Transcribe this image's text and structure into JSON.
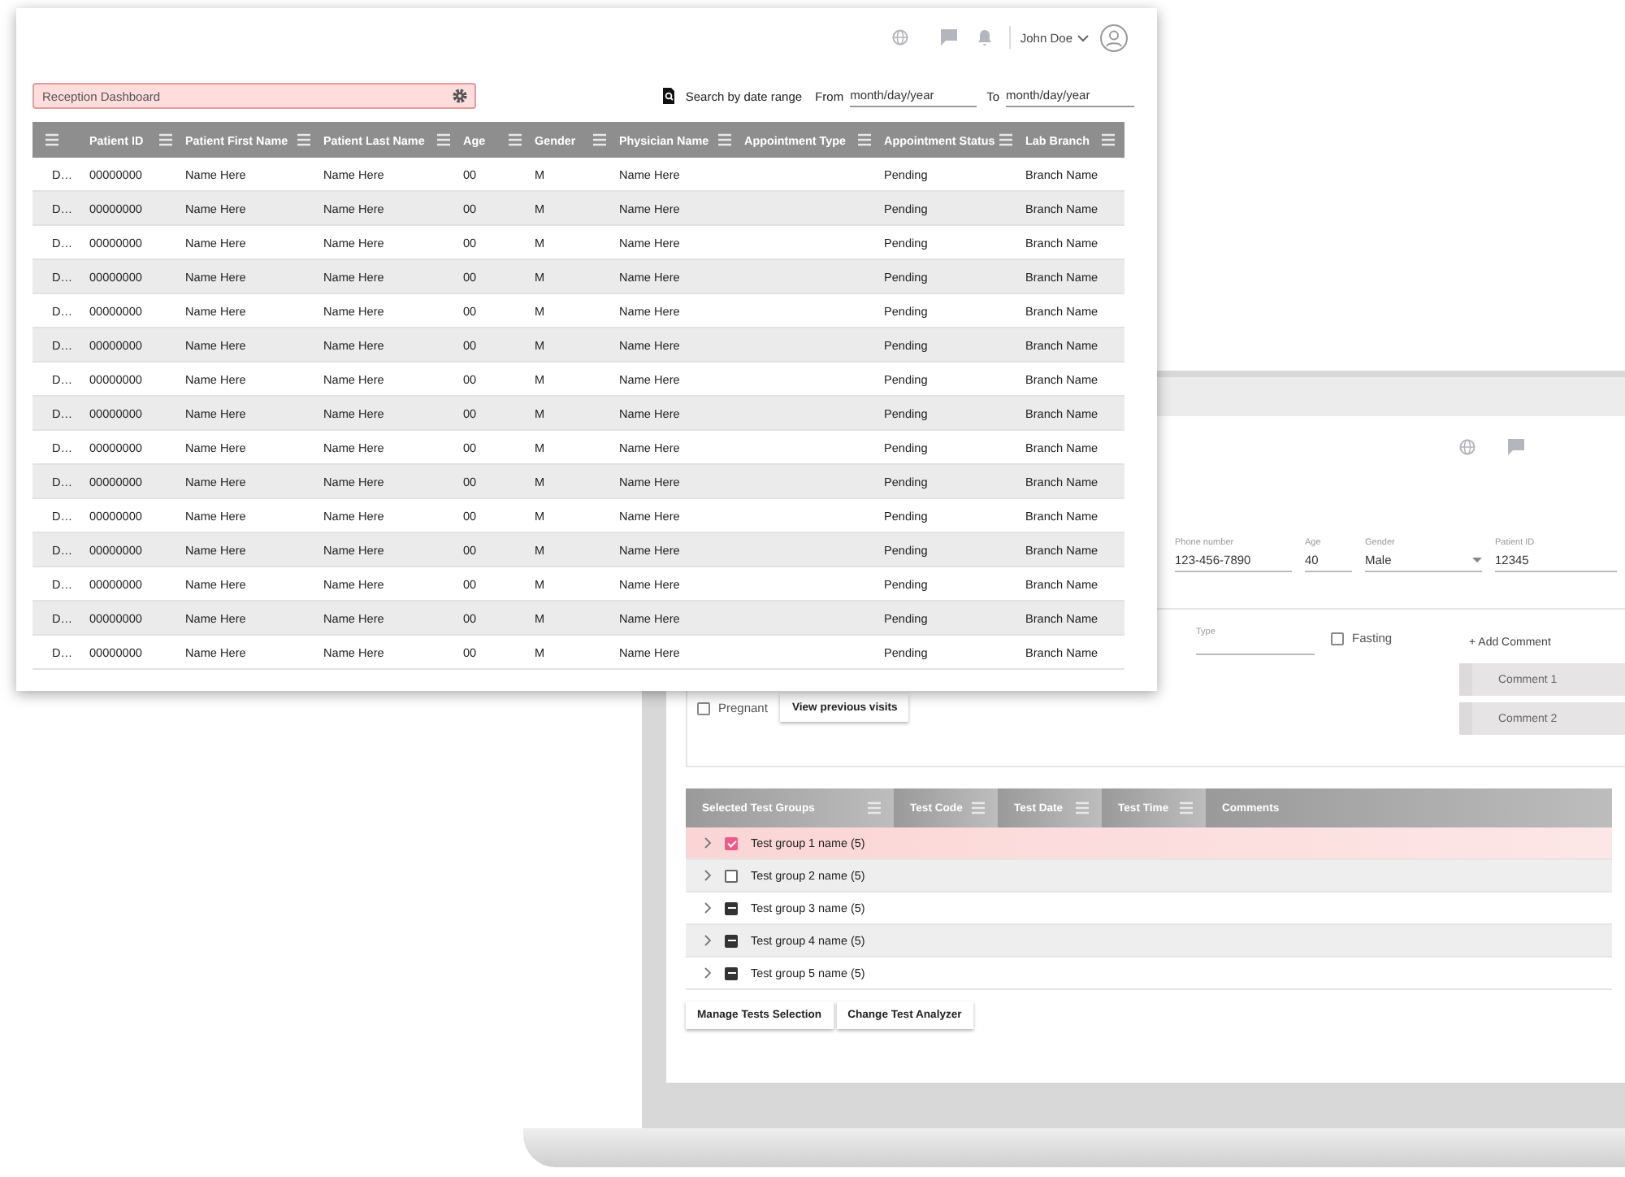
{
  "dashboard_window": {
    "header": {
      "user_name": "John Doe"
    },
    "title_field": {
      "value": "Reception Dashboard"
    },
    "date_search": {
      "label": "Search by date range",
      "from_label": "From",
      "from_placeholder": "month/day/year",
      "to_label": "To",
      "to_placeholder": "month/day/year"
    },
    "table": {
      "columns": [
        "Patient ID",
        "Patient First Name",
        "Patient Last Name",
        "Age",
        "Gender",
        "Physician Name",
        "Appointment Type",
        "Appointment Status",
        "Lab Branch"
      ],
      "rows": [
        {
          "column_1": "D…",
          "patient_id": "00000000",
          "first_name": "Name Here",
          "last_name": "Name Here",
          "age": "00",
          "gender": "M",
          "physician": "Name Here",
          "status": "Pending",
          "branch": "Branch Name"
        },
        {
          "column_1": "D…",
          "patient_id": "00000000",
          "first_name": "Name Here",
          "last_name": "Name Here",
          "age": "00",
          "gender": "M",
          "physician": "Name Here",
          "status": "Pending",
          "branch": "Branch Name"
        },
        {
          "column_1": "D…",
          "patient_id": "00000000",
          "first_name": "Name Here",
          "last_name": "Name Here",
          "age": "00",
          "gender": "M",
          "physician": "Name Here",
          "status": "Pending",
          "branch": "Branch Name"
        },
        {
          "column_1": "D…",
          "patient_id": "00000000",
          "first_name": "Name Here",
          "last_name": "Name Here",
          "age": "00",
          "gender": "M",
          "physician": "Name Here",
          "status": "Pending",
          "branch": "Branch Name"
        },
        {
          "column_1": "D…",
          "patient_id": "00000000",
          "first_name": "Name Here",
          "last_name": "Name Here",
          "age": "00",
          "gender": "M",
          "physician": "Name Here",
          "status": "Pending",
          "branch": "Branch Name"
        },
        {
          "column_1": "D…",
          "patient_id": "00000000",
          "first_name": "Name Here",
          "last_name": "Name Here",
          "age": "00",
          "gender": "M",
          "physician": "Name Here",
          "status": "Pending",
          "branch": "Branch Name"
        },
        {
          "column_1": "D…",
          "patient_id": "00000000",
          "first_name": "Name Here",
          "last_name": "Name Here",
          "age": "00",
          "gender": "M",
          "physician": "Name Here",
          "status": "Pending",
          "branch": "Branch Name"
        },
        {
          "column_1": "D…",
          "patient_id": "00000000",
          "first_name": "Name Here",
          "last_name": "Name Here",
          "age": "00",
          "gender": "M",
          "physician": "Name Here",
          "status": "Pending",
          "branch": "Branch Name"
        },
        {
          "column_1": "D…",
          "patient_id": "00000000",
          "first_name": "Name Here",
          "last_name": "Name Here",
          "age": "00",
          "gender": "M",
          "physician": "Name Here",
          "status": "Pending",
          "branch": "Branch Name"
        },
        {
          "column_1": "D…",
          "patient_id": "00000000",
          "first_name": "Name Here",
          "last_name": "Name Here",
          "age": "00",
          "gender": "M",
          "physician": "Name Here",
          "status": "Pending",
          "branch": "Branch Name"
        },
        {
          "column_1": "D…",
          "patient_id": "00000000",
          "first_name": "Name Here",
          "last_name": "Name Here",
          "age": "00",
          "gender": "M",
          "physician": "Name Here",
          "status": "Pending",
          "branch": "Branch Name"
        },
        {
          "column_1": "D…",
          "patient_id": "00000000",
          "first_name": "Name Here",
          "last_name": "Name Here",
          "age": "00",
          "gender": "M",
          "physician": "Name Here",
          "status": "Pending",
          "branch": "Branch Name"
        },
        {
          "column_1": "D…",
          "patient_id": "00000000",
          "first_name": "Name Here",
          "last_name": "Name Here",
          "age": "00",
          "gender": "M",
          "physician": "Name Here",
          "status": "Pending",
          "branch": "Branch Name"
        },
        {
          "column_1": "D…",
          "patient_id": "00000000",
          "first_name": "Name Here",
          "last_name": "Name Here",
          "age": "00",
          "gender": "M",
          "physician": "Name Here",
          "status": "Pending",
          "branch": "Branch Name"
        },
        {
          "column_1": "D…",
          "patient_id": "00000000",
          "first_name": "Name Here",
          "last_name": "Name Here",
          "age": "00",
          "gender": "M",
          "physician": "Name Here",
          "status": "Pending",
          "branch": "Branch Name"
        }
      ]
    }
  },
  "patient_screen": {
    "fields": [
      {
        "label": "Phone number",
        "value": "123-456-7890",
        "kind": "text"
      },
      {
        "label": "Age",
        "value": "40",
        "kind": "text"
      },
      {
        "label": "Gender",
        "value": "Male",
        "kind": "select"
      },
      {
        "label": "Patient ID",
        "value": "12345",
        "kind": "text"
      }
    ],
    "type_field": {
      "label": "Type"
    },
    "fasting": {
      "label": "Fasting",
      "checked": false
    },
    "pregnant": {
      "label": "Pregnant",
      "checked": false
    },
    "view_previous_visits": "View previous visits",
    "add_comment": "+ Add Comment",
    "comments": [
      "Comment 1",
      "Comment 2"
    ],
    "test_table": {
      "columns": [
        {
          "label": "Selected Test Groups",
          "menu": true
        },
        {
          "label": "Test Code",
          "menu": true
        },
        {
          "label": "Test Date",
          "menu": true
        },
        {
          "label": "Test Time",
          "menu": true
        },
        {
          "label": "Comments",
          "menu": false
        }
      ],
      "rows": [
        {
          "name": "Test group 1 name (5)",
          "kind": "checked",
          "selected": true
        },
        {
          "name": "Test group 2 name (5)",
          "kind": "unchecked",
          "selected": false
        },
        {
          "name": "Test group 3 name (5)",
          "kind": "partial",
          "selected": false
        },
        {
          "name": "Test group 4 name (5)",
          "kind": "partial",
          "selected": false
        },
        {
          "name": "Test group 5 name (5)",
          "kind": "partial",
          "selected": false
        }
      ]
    },
    "buttons": [
      "Manage Tests Selection",
      "Change Test Analyzer"
    ]
  }
}
